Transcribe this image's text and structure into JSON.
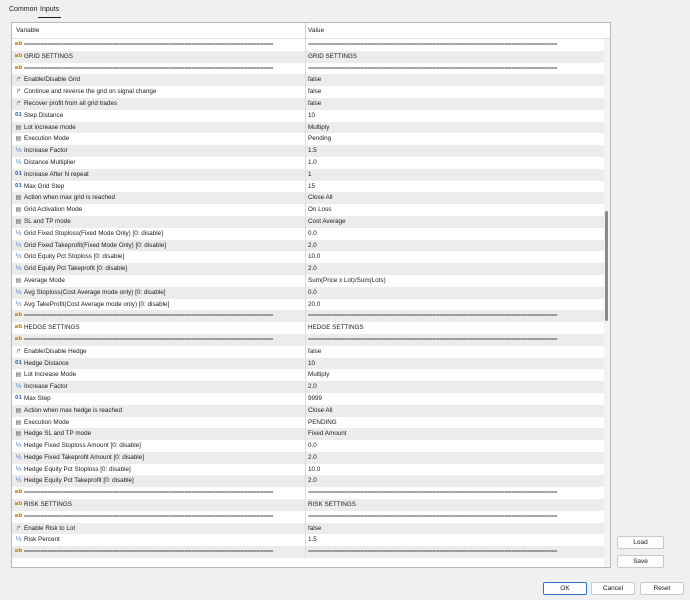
{
  "tabs": [
    {
      "label": "Common"
    },
    {
      "label": "Inputs"
    }
  ],
  "grid": {
    "col_variable": "Variable",
    "col_value": "Value",
    "rows": [
      {
        "icon": "ab",
        "var": "============================================================================",
        "val": "============================================================================"
      },
      {
        "icon": "ab",
        "var": "GRID SETTINGS",
        "val": "GRID SETTINGS"
      },
      {
        "icon": "ab",
        "var": "============================================================================",
        "val": "============================================================================"
      },
      {
        "icon": "arrow",
        "var": "Enable/Disable Grid",
        "val": "false"
      },
      {
        "icon": "arrow",
        "var": "Continue and reverse the grid on signal change",
        "val": "false"
      },
      {
        "icon": "arrow",
        "var": "Recover profit from all grid trades",
        "val": "false"
      },
      {
        "icon": "num",
        "var": "Step Distance",
        "val": "10"
      },
      {
        "icon": "list",
        "var": "Lot increase mode",
        "val": "Multiply"
      },
      {
        "icon": "list",
        "var": "Execution Mode",
        "val": "Pending"
      },
      {
        "icon": "half",
        "var": "Increase Factor",
        "val": "1.5"
      },
      {
        "icon": "half",
        "var": "Distance Multiplier",
        "val": "1.0"
      },
      {
        "icon": "num",
        "var": "Increase After N repeat",
        "val": "1"
      },
      {
        "icon": "num",
        "var": "Max Grid Step",
        "val": "15"
      },
      {
        "icon": "list",
        "var": "Action when max grid is reached",
        "val": "Close All"
      },
      {
        "icon": "list",
        "var": "Grid Activation Mode",
        "val": "On Loss"
      },
      {
        "icon": "list",
        "var": "SL and TP mode",
        "val": "Cost Average"
      },
      {
        "icon": "half",
        "var": "Grid Fixed Stoploss(Fixed Mode Only) [0: disable]",
        "val": "0.0"
      },
      {
        "icon": "half",
        "var": "Grid Fixed Takeprofit(Fixed Mode Only) [0: disable]",
        "val": "2.0"
      },
      {
        "icon": "half",
        "var": "Grid Equity Pct Stoploss [0: disable]",
        "val": "10.0"
      },
      {
        "icon": "half",
        "var": "Grid Equity Pct Takeprofit [0: disable]",
        "val": "2.0"
      },
      {
        "icon": "list",
        "var": "Average Mode",
        "val": "Sum(Price x Lot)/Sum(Lots)"
      },
      {
        "icon": "half",
        "var": "Avg Stoploss(Cost Average mode only) [0: disable]",
        "val": "0.0"
      },
      {
        "icon": "half",
        "var": "Avg TakeProfit(Cost Average mode only) [0: disable]",
        "val": "20.0"
      },
      {
        "icon": "ab",
        "var": "============================================================================",
        "val": "============================================================================"
      },
      {
        "icon": "ab",
        "var": "HEDGE SETTINGS",
        "val": "HEDGE SETTINGS"
      },
      {
        "icon": "ab",
        "var": "============================================================================",
        "val": "============================================================================"
      },
      {
        "icon": "arrow",
        "var": "Enable/Disable Hedge",
        "val": "false"
      },
      {
        "icon": "num",
        "var": "Hedge Distance",
        "val": "10"
      },
      {
        "icon": "list",
        "var": "Lot Increase Mode",
        "val": "Multiply"
      },
      {
        "icon": "half",
        "var": "Increase Factor",
        "val": "2.0"
      },
      {
        "icon": "num",
        "var": "Max Step",
        "val": "9999"
      },
      {
        "icon": "list",
        "var": "Action when max hedge is reached",
        "val": "Close All"
      },
      {
        "icon": "list",
        "var": "Execution Mode",
        "val": "PENDING"
      },
      {
        "icon": "list",
        "var": "Hedge SL and TP mode",
        "val": "Fixed Amount"
      },
      {
        "icon": "half",
        "var": "Hedge Fixed Stoploss Amount [0: disable]",
        "val": "0.0"
      },
      {
        "icon": "half",
        "var": "Hedge Fixed Takeprofit Amount [0: disable]",
        "val": "2.0"
      },
      {
        "icon": "half",
        "var": "Hedge Equity Pct Stoploss [0: disable]",
        "val": "10.0"
      },
      {
        "icon": "half",
        "var": "Hedge Equity Pct Takeprofit [0: disable]",
        "val": "2.0"
      },
      {
        "icon": "ab",
        "var": "============================================================================",
        "val": "============================================================================"
      },
      {
        "icon": "ab",
        "var": "RISK SETTINGS",
        "val": "RISK SETTINGS"
      },
      {
        "icon": "ab",
        "var": "============================================================================",
        "val": "============================================================================"
      },
      {
        "icon": "arrow",
        "var": "Enable Risk to Lot",
        "val": "false"
      },
      {
        "icon": "half",
        "var": "Risk Percent",
        "val": "1.5"
      },
      {
        "icon": "ab",
        "var": "============================================================================",
        "val": "============================================================================"
      }
    ]
  },
  "icon_glyphs": {
    "ab": "ab",
    "arrow": "↱",
    "num": "01",
    "list": "▤",
    "half": "½"
  },
  "buttons": {
    "load": "Load",
    "save": "Save",
    "ok": "OK",
    "cancel": "Cancel",
    "reset": "Reset"
  },
  "colors": {
    "accent": "#2d6fd2",
    "row_alt": "#ececec"
  }
}
